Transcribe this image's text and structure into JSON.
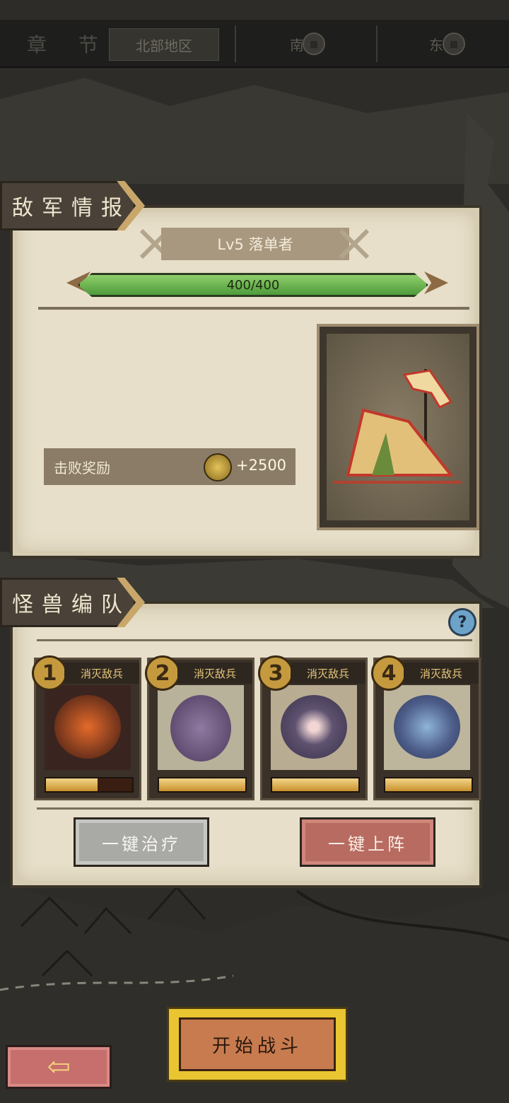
{
  "chapter": {
    "label": "章 节",
    "tabs": [
      {
        "label": "北部地区",
        "locked": false
      },
      {
        "label": "南 区",
        "locked": true
      },
      {
        "label": "东 区",
        "locked": true
      }
    ]
  },
  "enemy_section": {
    "title": "敌军情报",
    "enemy_name": "Lv5 落单者",
    "hp_text": "400/400",
    "reward_label": "击败奖励",
    "reward_value": "+2500"
  },
  "team_section": {
    "title": "怪兽编队",
    "help_icon": "?",
    "monsters": [
      {
        "slot": "1",
        "status": "消灭敌兵",
        "hp": 0.6
      },
      {
        "slot": "2",
        "status": "消灭敌兵",
        "hp": 1.0
      },
      {
        "slot": "3",
        "status": "消灭敌兵",
        "hp": 1.0
      },
      {
        "slot": "4",
        "status": "消灭敌兵",
        "hp": 1.0
      }
    ],
    "heal_all_label": "一键治疗",
    "deploy_all_label": "一键上阵"
  },
  "footer": {
    "start_battle_label": "开始战斗"
  },
  "colors": {
    "parchment": "#e7dfc9",
    "hp_green": "#4e9b3c",
    "start_yellow": "#e9c531",
    "deploy_red": "#b86b61"
  }
}
